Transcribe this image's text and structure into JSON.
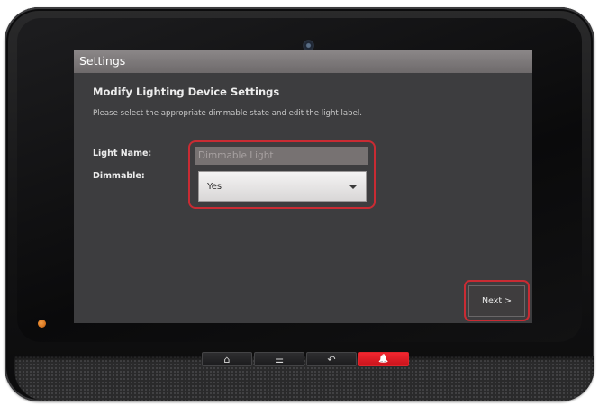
{
  "window": {
    "title": "Settings"
  },
  "page": {
    "heading": "Modify Lighting Device Settings",
    "instructions": "Please select the appropriate dimmable state and edit the light label."
  },
  "form": {
    "light_name": {
      "label": "Light Name:",
      "placeholder": "Dimmable Light"
    },
    "dimmable": {
      "label": "Dimmable:",
      "value": "Yes"
    }
  },
  "footer": {
    "next_label": "Next >"
  },
  "hardware_buttons": [
    {
      "icon": "home-icon",
      "glyph": "⌂"
    },
    {
      "icon": "menu-icon",
      "glyph": "☰"
    },
    {
      "icon": "back-icon",
      "glyph": "↶"
    },
    {
      "icon": "alarm-icon",
      "glyph": "🔔"
    }
  ],
  "colors": {
    "highlight": "#c92b33",
    "alarm_button": "#e2202a",
    "titlebar": "#7d797a",
    "screen_background": "#3d3d3f",
    "status_led": "#e0862a"
  }
}
